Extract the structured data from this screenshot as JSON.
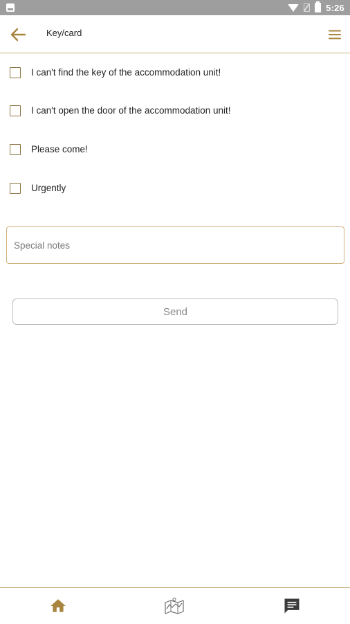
{
  "status_bar": {
    "time": "5:26"
  },
  "app_bar": {
    "title": "Key/card",
    "back_icon": "arrow-left-icon",
    "menu_icon": "hamburger-menu-icon"
  },
  "options": [
    {
      "label": "I can't find the key of the accommodation unit!",
      "checked": false
    },
    {
      "label": "I can't open the door of the accommodation unit!",
      "checked": false
    },
    {
      "label": "Please come!",
      "checked": false
    },
    {
      "label": "Urgently",
      "checked": false
    }
  ],
  "notes": {
    "placeholder": "Special notes",
    "value": ""
  },
  "send_button": {
    "label": "Send"
  },
  "bottom_nav": [
    {
      "icon": "home-icon",
      "active": true
    },
    {
      "icon": "map-icon",
      "active": false
    },
    {
      "icon": "chat-icon",
      "active": false
    }
  ],
  "colors": {
    "accent": "#a8843f",
    "divider": "#c9ad7a",
    "icon_dark": "#3a3a3a"
  }
}
